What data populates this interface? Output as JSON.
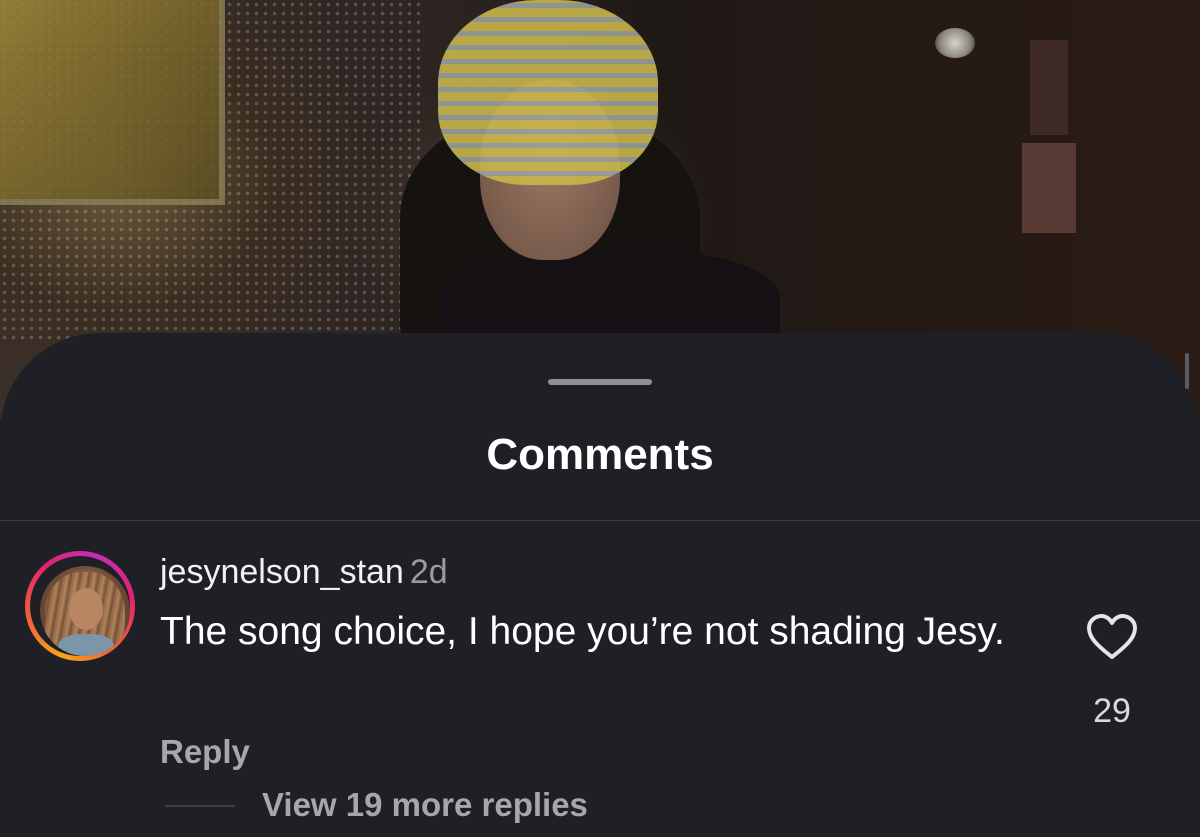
{
  "sheet": {
    "title": "Comments"
  },
  "comment": {
    "username": "jesynelson_stan",
    "timestamp": "2d",
    "text": "The song choice, I hope you’re not shading Jesy.",
    "reply_label": "Reply",
    "like_count": "29",
    "view_replies_label": "View 19 more replies",
    "avatar_ring_colors": [
      "#f7a41a",
      "#e0246e",
      "#c42db8"
    ]
  },
  "icons": {
    "like": "heart-outline-icon"
  },
  "colors": {
    "sheet_bg": "#1f2026",
    "secondary_text": "#a6a7ad"
  }
}
